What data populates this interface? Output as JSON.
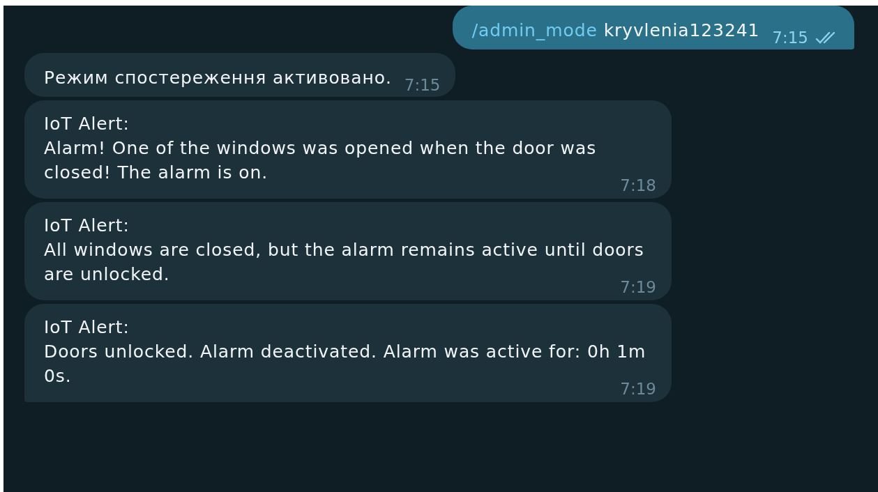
{
  "messages": [
    {
      "kind": "outgoing",
      "command": "/admin_mode",
      "text": "kryvlenia123241",
      "time": "7:15",
      "read": true,
      "tail": true
    },
    {
      "kind": "incoming",
      "text": "Режим спостереження активовано.",
      "time": "7:15",
      "tail": false
    },
    {
      "kind": "incoming",
      "text": "IoT Alert:\nAlarm! One of the windows was opened when the door was closed! The alarm is on.",
      "time": "7:18",
      "tail": false
    },
    {
      "kind": "incoming",
      "text": "IoT Alert:\nAll windows are closed, but the alarm remains active until doors are unlocked.",
      "time": "7:19",
      "tail": false
    },
    {
      "kind": "incoming",
      "text": "IoT Alert:\nDoors unlocked. Alarm deactivated. Alarm was active for: 0h 1m 0s.",
      "time": "7:19",
      "tail": true
    }
  ]
}
